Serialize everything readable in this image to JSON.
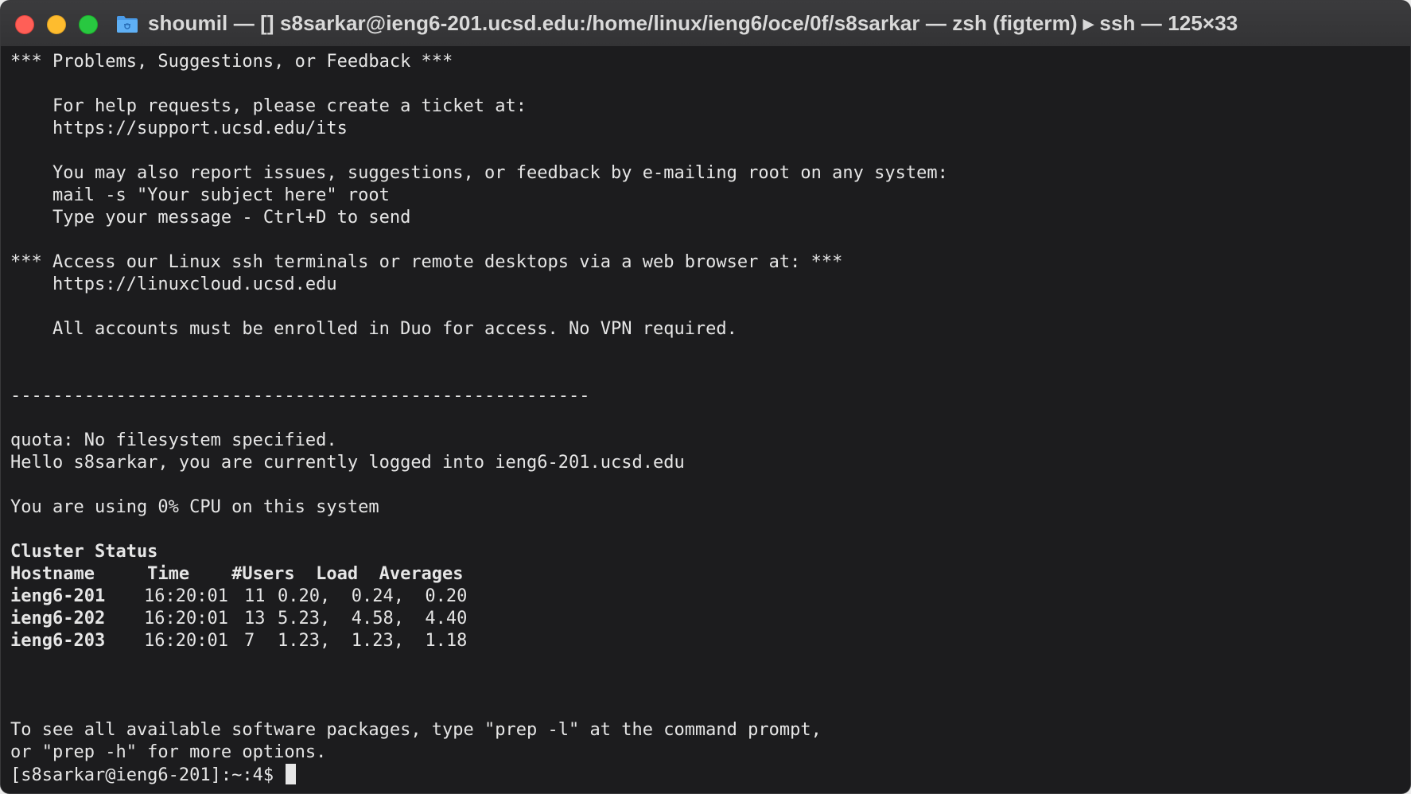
{
  "window": {
    "title": "shoumil — []  s8sarkar@ieng6-201.ucsd.edu:/home/linux/ieng6/oce/0f/s8sarkar — zsh (figterm) ▸ ssh — 125×33"
  },
  "icons": {
    "close": "close-icon",
    "minimize": "minimize-icon",
    "zoom": "zoom-icon",
    "folder": "folder-icon"
  },
  "colors": {
    "background": "#1c1c1e",
    "text": "#e6e6e6",
    "titlebar": "#353537",
    "close": "#ff5f57",
    "minimize": "#febc2e",
    "zoom": "#28c840",
    "folder": "#4a9be8"
  },
  "terminal": {
    "motd": [
      "*** Problems, Suggestions, or Feedback ***",
      "",
      "    For help requests, please create a ticket at:",
      "    https://support.ucsd.edu/its",
      "",
      "    You may also report issues, suggestions, or feedback by e-mailing root on any system:",
      "    mail -s \"Your subject here\" root",
      "    Type your message - Ctrl+D to send",
      "",
      "*** Access our Linux ssh terminals or remote desktops via a web browser at: ***",
      "    https://linuxcloud.ucsd.edu",
      "",
      "    All accounts must be enrolled in Duo for access. No VPN required.",
      "",
      "",
      "-------------------------------------------------------",
      "",
      "quota: No filesystem specified.",
      "Hello s8sarkar, you are currently logged into ieng6-201.ucsd.edu",
      "",
      "You are using 0% CPU on this system",
      ""
    ],
    "cluster": {
      "title": "Cluster Status",
      "headers": [
        "Hostname",
        "Time",
        "#Users",
        "Load",
        "Averages"
      ],
      "header_line": "Hostname     Time    #Users  Load  Averages",
      "rows": [
        {
          "host": "ieng6-201",
          "time": "16:20:01",
          "users": "11",
          "load": "0.20,  0.24,  0.20"
        },
        {
          "host": "ieng6-202",
          "time": "16:20:01",
          "users": "13",
          "load": "5.23,  4.58,  4.40"
        },
        {
          "host": "ieng6-203",
          "time": "16:20:01",
          "users": "7",
          "load": "1.23,  1.23,  1.18"
        }
      ]
    },
    "footer": [
      "",
      "",
      "",
      "To see all available software packages, type \"prep -l\" at the command prompt,",
      "or \"prep -h\" for more options."
    ],
    "prompt": "[s8sarkar@ieng6-201]:~:4$ "
  }
}
